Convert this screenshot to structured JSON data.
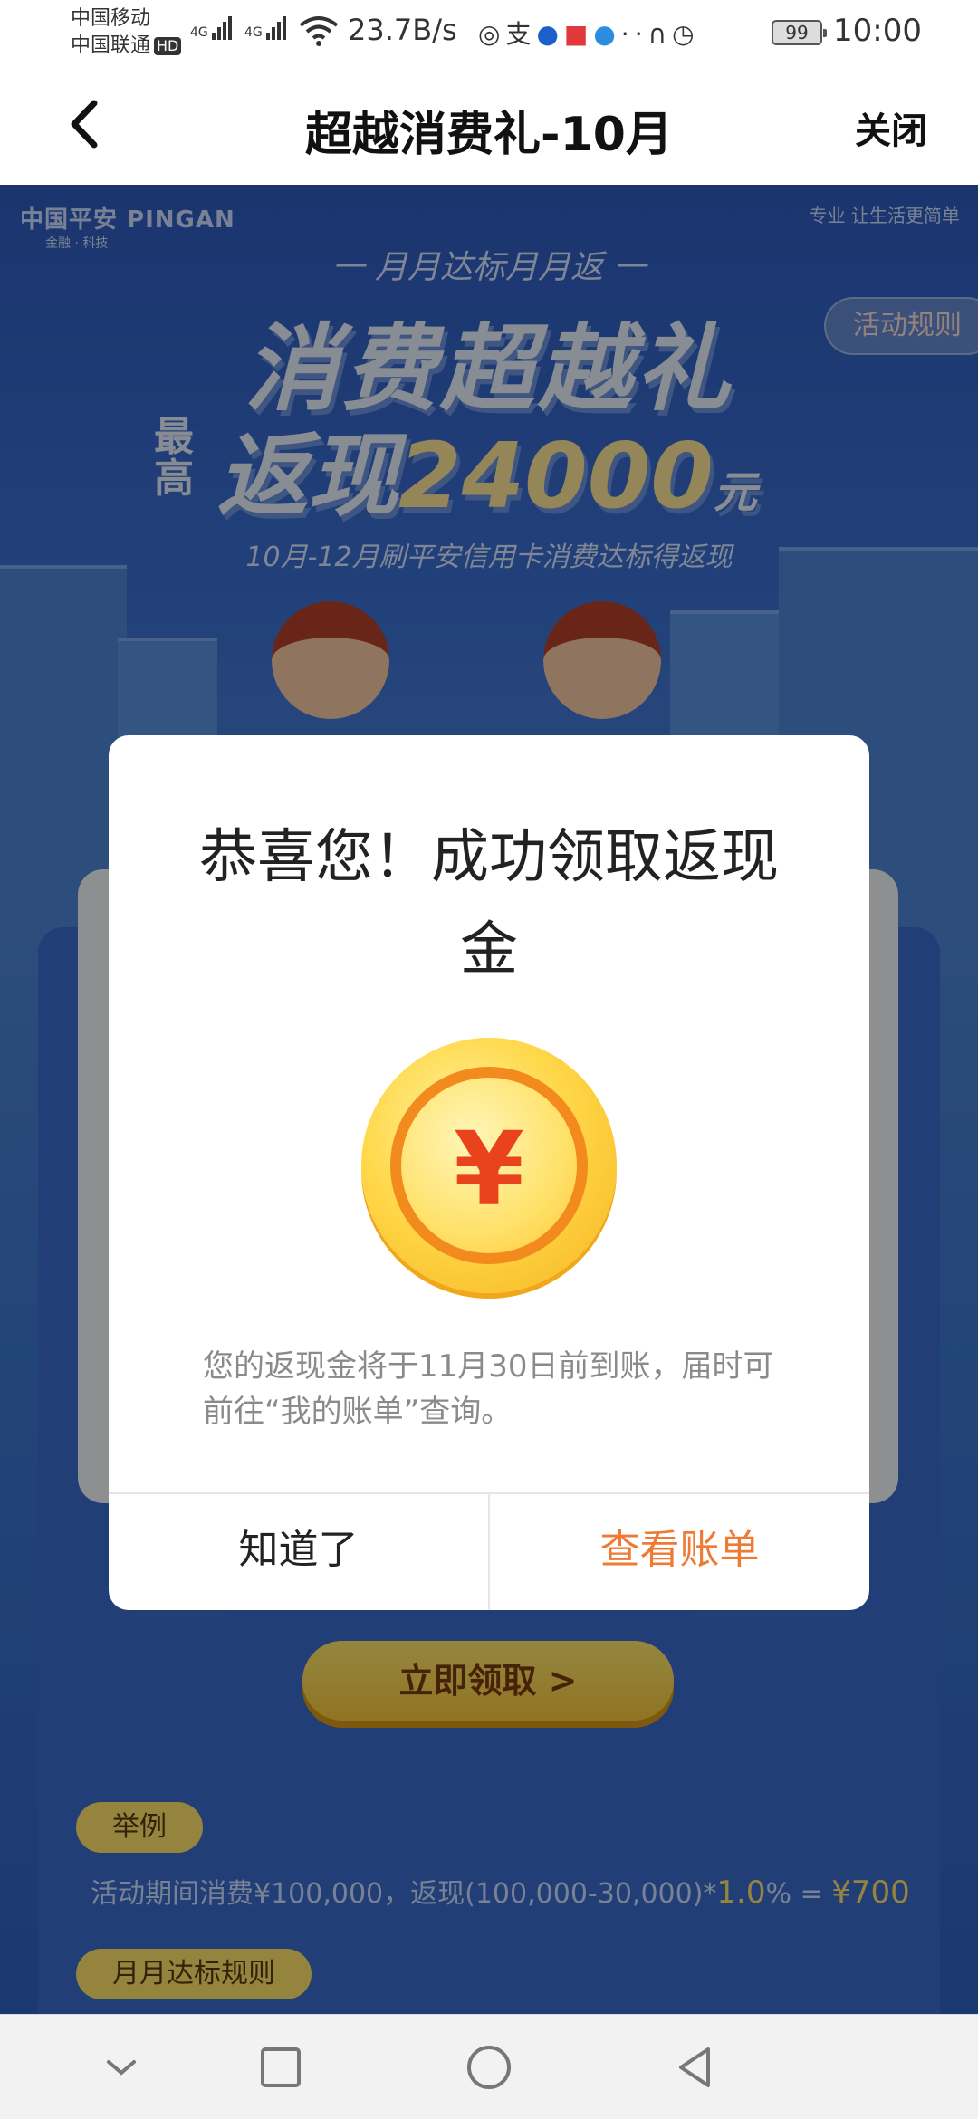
{
  "status_bar": {
    "carrier_1": "中国移动",
    "carrier_2": "中国联通",
    "hd_badge": "HD",
    "sim1_type": "4G",
    "sim2_type": "4G",
    "net_speed": "23.7B/s",
    "battery": "99",
    "time": "10:00",
    "icons": [
      "wifi-icon",
      "wechat-icon",
      "alipay-icon",
      "app-icon",
      "reader-icon",
      "browser-icon",
      "headset-icon",
      "alarm-icon"
    ]
  },
  "nav": {
    "title": "超越消费礼-10月",
    "close_label": "关闭"
  },
  "page": {
    "brand": "中国平安 PINGAN",
    "brand_sub": "金融 · 科技",
    "slogan": "专业 让生活更简单",
    "rules_label": "活动规则",
    "hero_tag": "一 月月达标月月返 一",
    "hero_title": "消费超越礼",
    "hero_max": "最高",
    "hero_prefix": "返现",
    "hero_amount": "24000",
    "hero_unit": "元",
    "hero_desc": "10月-12月刷平安信用卡消费达标得返现",
    "claim_label": "立即领取 >",
    "example_pill": "举例",
    "example_text": "活动期间消费¥100,000，返现(100,000-30,000)*",
    "example_rate": "1.0",
    "example_pct": "% = ",
    "example_result": "¥700",
    "monthly_rules_pill": "月月达标规则"
  },
  "modal": {
    "title": "恭喜您！成功领取返现金",
    "coin_symbol": "¥",
    "message": "您的返现金将于11月30日前到账，届时可前往“我的账单”查询。",
    "btn_ok": "知道了",
    "btn_bill": "查看账单"
  },
  "colors": {
    "accent_orange": "#ee7a34",
    "page_blue": "#3a6fd2",
    "coin_gold": "#ffd84a",
    "yen_red": "#e8431c"
  }
}
